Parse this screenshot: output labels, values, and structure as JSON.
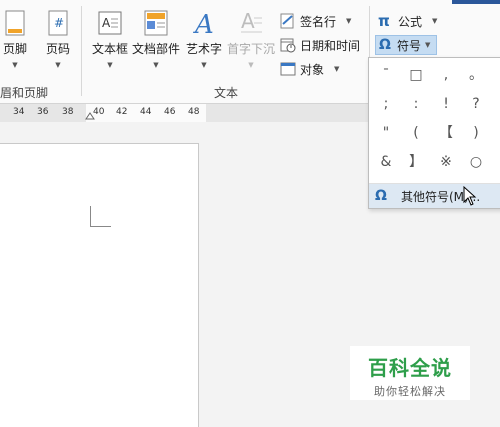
{
  "ribbon": {
    "buttons": [
      {
        "label": "页脚"
      },
      {
        "label": "页码"
      },
      {
        "label": "文本框"
      },
      {
        "label": "文档部件"
      },
      {
        "label": "艺术字"
      },
      {
        "label": "首字下沉"
      }
    ],
    "small_buttons": {
      "signature": "签名行",
      "datetime": "日期和时间",
      "object": "对象",
      "equation": "公式",
      "symbol": "符号"
    },
    "groups": {
      "header_footer": "眉和页脚",
      "text": "文本"
    },
    "equation_glyph": "π",
    "symbol_glyph": "Ω"
  },
  "ruler": {
    "ticks": [
      "34",
      "36",
      "38",
      "40",
      "42",
      "44",
      "46",
      "48"
    ]
  },
  "symbol_menu": {
    "symbols": [
      [
        "¯",
        "□",
        ",",
        "。"
      ],
      [
        ";",
        ":",
        "!",
        "?"
      ],
      [
        "\"",
        "(",
        "【",
        ")"
      ],
      [
        "&",
        "】",
        "※",
        "○"
      ]
    ],
    "more_label": "其他符号(M)...",
    "more_glyph": "Ω"
  },
  "watermark": {
    "title": "百科全说",
    "subtitle": "助你轻松解决"
  },
  "colors": {
    "accent": "#2b6cb0",
    "hover": "#dde8f3"
  }
}
